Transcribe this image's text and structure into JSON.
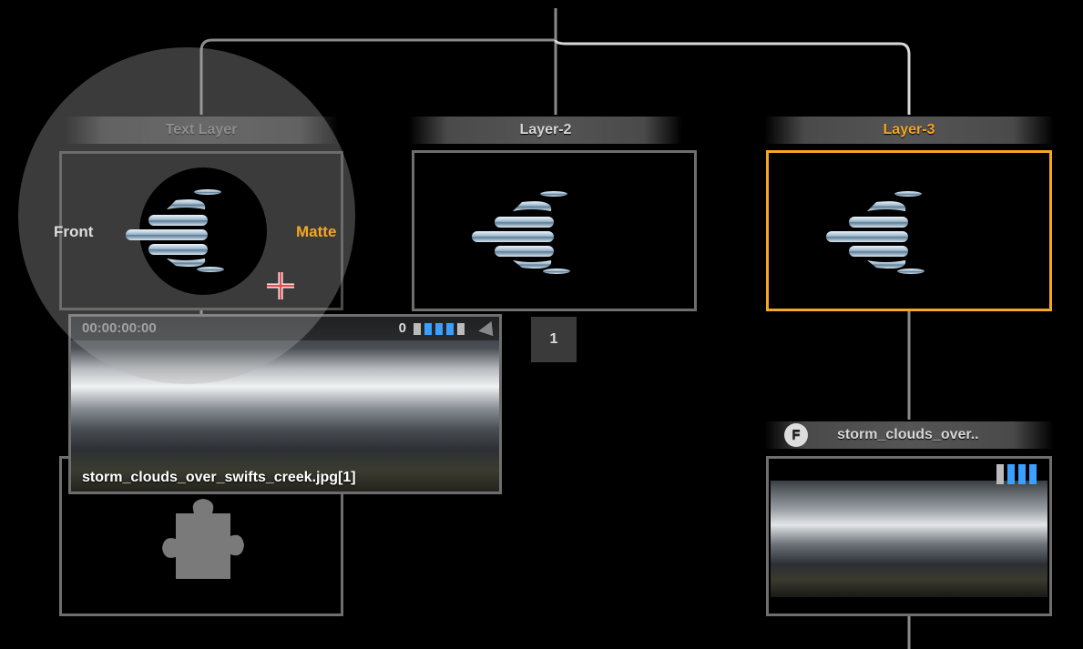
{
  "layers": [
    {
      "id": "text-layer",
      "label": "Text Layer"
    },
    {
      "id": "layer-2",
      "label": "Layer-2"
    },
    {
      "id": "layer-3",
      "label": "Layer-3"
    }
  ],
  "merge_badge": "1",
  "clip_popup": {
    "timecode": "00:00:00:00",
    "frame": "0",
    "filename": "storm_clouds_over_swifts_creek.jpg[1]"
  },
  "ring_menu": {
    "front": "Front",
    "matte": "Matte"
  },
  "file_node": {
    "flag": "F",
    "name": "storm_clouds_over.."
  },
  "colors": {
    "active": "#f5a623",
    "node_border": "#6e6e6e",
    "wire": "#8a8a8a",
    "channel_blue": "#3aa0ff"
  }
}
